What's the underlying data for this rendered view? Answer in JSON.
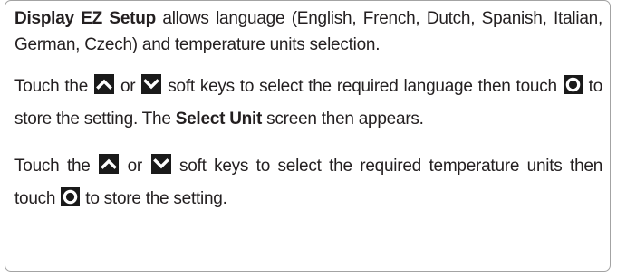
{
  "para1": {
    "title": "Display EZ Setup",
    "text": " allows language (English, French, Dutch, Spanish, Italian, German, Czech) and temperature units selection."
  },
  "para2": {
    "t1": "Touch the ",
    "t2": " or ",
    "t3": " soft keys to select the required language then touch ",
    "t4": " to store the setting. The ",
    "bold": "Select Unit",
    "t5": " screen then appears."
  },
  "para3": {
    "t1": "Touch the ",
    "t2": " or ",
    "t3": " soft keys to select the required temperature units then touch ",
    "t4": " to store the setting."
  },
  "icons": {
    "up": "chevron-up-icon",
    "down": "chevron-down-icon",
    "ok": "circle-ok-icon"
  },
  "colors": {
    "text": "#231f20",
    "key_background": "#1a1a1a",
    "key_glyph": "#ffffff",
    "border": "#a3a3a3"
  }
}
